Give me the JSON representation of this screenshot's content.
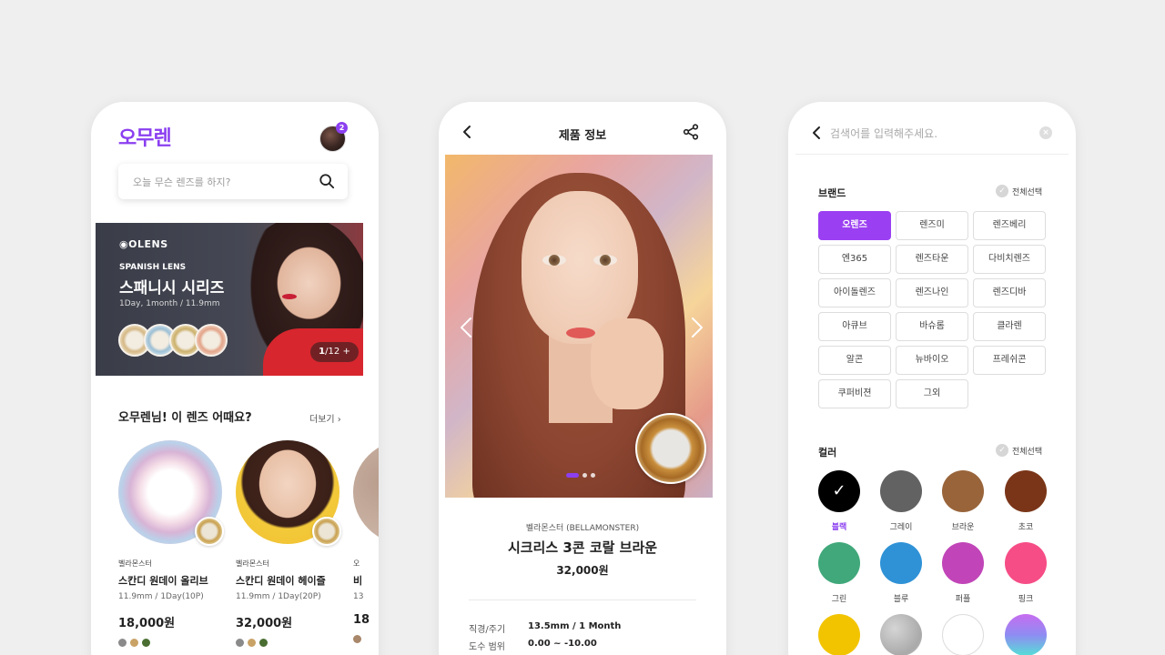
{
  "home": {
    "logo": "오무렌",
    "notification_count": "2",
    "search_placeholder": "오늘 무슨 렌즈를 하지?",
    "banner": {
      "brand": "OLENS",
      "subtitle": "SPANISH LENS",
      "title": "스패니시 시리즈",
      "spec": "1Day, 1month / 11.9mm",
      "counter_current": "1",
      "counter_sep": "/",
      "counter_total": "12",
      "counter_plus": "+"
    },
    "section_title": "오무렌님! 이 렌즈 어때요?",
    "more": "더보기 ›",
    "products": [
      {
        "brand": "벨라몬스터",
        "name": "스칸디 원데이 올리브",
        "spec": "11.9mm / 1Day(10P)",
        "price": "18,000원",
        "colors": [
          "#8a8a8a",
          "#c9a266",
          "#4a6e32"
        ]
      },
      {
        "brand": "벨라몬스터",
        "name": "스칸디 원데이 헤이즐",
        "spec": "11.9mm / 1Day(20P)",
        "price": "32,000원",
        "colors": [
          "#8a8a8a",
          "#c9a266",
          "#4a6e32"
        ]
      },
      {
        "brand": "오",
        "name": "비",
        "spec": "13",
        "price": "18",
        "colors": [
          "#a8876a"
        ]
      }
    ]
  },
  "detail": {
    "title": "제품 정보",
    "brand": "벨라몬스터 (BELLAMONSTER)",
    "name": "시크리스 3콘 코랄 브라운",
    "price": "32,000원",
    "specs": [
      {
        "label": "직경/주기",
        "value": "13.5mm / 1 Month"
      },
      {
        "label": "도수 범위",
        "value": "0.00 ~ -10.00"
      }
    ]
  },
  "filter": {
    "search_placeholder": "검색어를 입력해주세요.",
    "brand_label": "브랜드",
    "color_label": "컬러",
    "select_all": "전체선택",
    "brands": [
      "오렌즈",
      "렌즈미",
      "렌즈베리",
      "엔365",
      "렌즈타운",
      "다비치렌즈",
      "아이돌렌즈",
      "렌즈나인",
      "렌즈디바",
      "아큐브",
      "바슈롬",
      "클라렌",
      "알콘",
      "뉴바이오",
      "프레쉬콘",
      "쿠퍼비젼",
      "그외"
    ],
    "selected_brand": "오렌즈",
    "colors": [
      {
        "name": "블랙",
        "hex": "#000000",
        "selected": true
      },
      {
        "name": "그레이",
        "hex": "#626262"
      },
      {
        "name": "브라운",
        "hex": "#99643a"
      },
      {
        "name": "초코",
        "hex": "#7a3518"
      },
      {
        "name": "그린",
        "hex": "#40a87a"
      },
      {
        "name": "블루",
        "hex": "#2f92d6"
      },
      {
        "name": "퍼플",
        "hex": "#c145b8"
      },
      {
        "name": "핑크",
        "hex": "#f64d86"
      },
      {
        "name": "",
        "hex": "#f2c400"
      },
      {
        "name": "",
        "hex": "#b9b9b9"
      },
      {
        "name": "",
        "hex": "#ffffff"
      },
      {
        "name": "",
        "hex": "#b56cf0"
      }
    ],
    "accent": "#9b3ff2"
  }
}
